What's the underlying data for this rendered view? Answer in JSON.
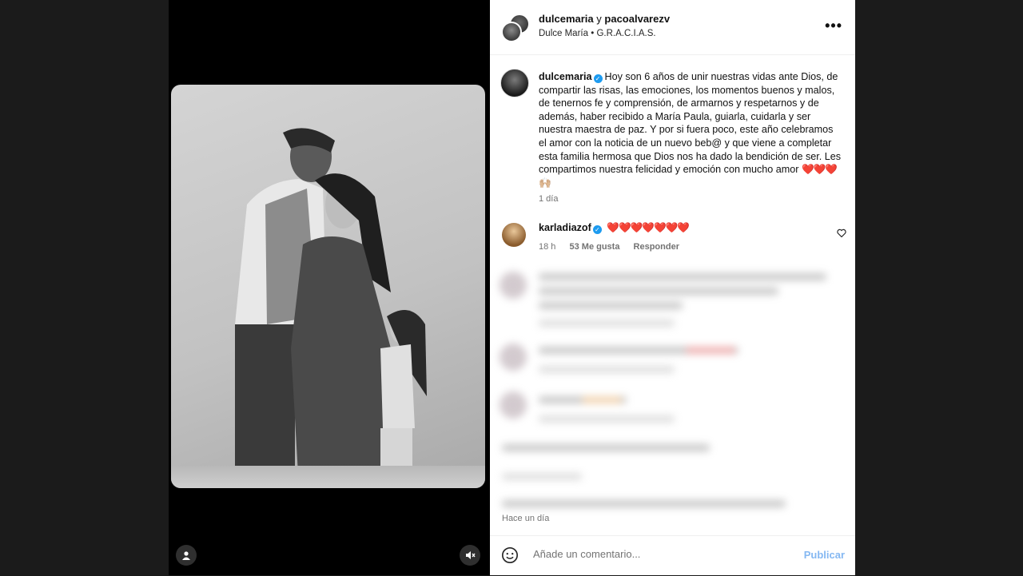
{
  "header": {
    "user1": "dulcemaria",
    "joiner": "y",
    "user2": "pacoalvarezv",
    "sub_name": "Dulce María",
    "sub_sep": "•",
    "sub_audio": "G.R.A.C.I.A.S.",
    "more": "•••"
  },
  "caption": {
    "username": "dulcemaria",
    "text": "Hoy son 6 años de unir nuestras vidas ante Dios, de compartir las risas, las emociones, los momentos buenos y malos, de tenernos fe y comprensión, de armarnos y respetarnos y de además, haber recibido a María Paula, guiarla, cuidarla y ser nuestra maestra de paz. Y por si fuera poco, este año celebramos el amor con la noticia de un nuevo beb@ y que viene a completar esta familia hermosa que Dios nos ha dado la bendición de ser. Les compartimos nuestra felicidad y emoción con mucho amor",
    "emojis": "❤️❤️❤️🙌🏼",
    "time": "1 día"
  },
  "comment": {
    "username": "karladiazof",
    "hearts": "❤️❤️❤️❤️❤️❤️❤️",
    "time": "18 h",
    "likes": "53 Me gusta",
    "reply": "Responder"
  },
  "footer": {
    "post_time": "Hace un día",
    "input_placeholder": "Añade un comentario...",
    "publish": "Publicar"
  },
  "colors": {
    "accent": "#0095f6",
    "verified": "#1d9bf0",
    "heart": "#e0245e"
  },
  "icons": {
    "tag": "user-tag-icon",
    "mute": "speaker-muted-icon",
    "emoji": "emoji-smile-icon",
    "like": "heart-outline-icon"
  }
}
